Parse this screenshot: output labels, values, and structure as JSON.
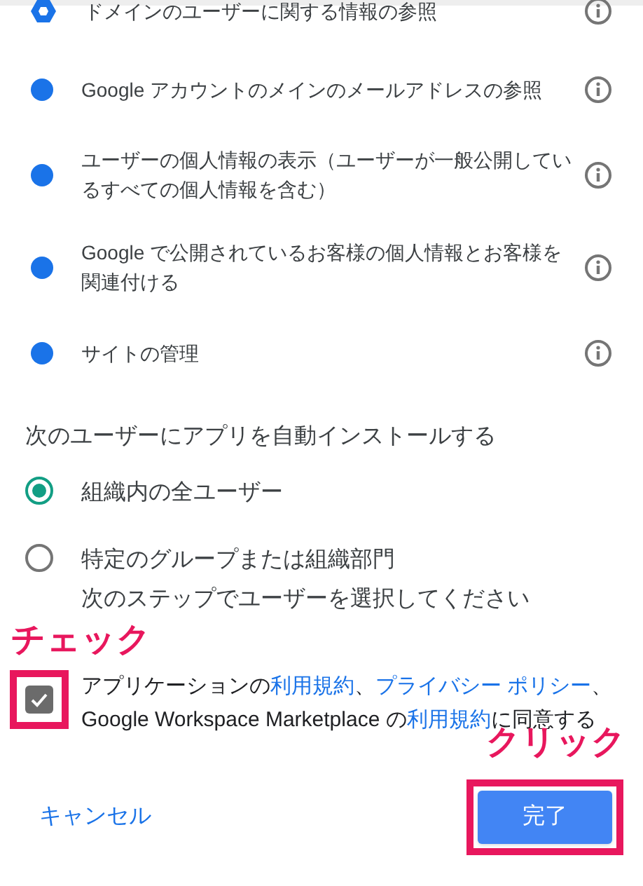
{
  "permissions": [
    {
      "text": "ドメインのユーザーに関する情報の参照",
      "kind": "hexagon"
    },
    {
      "text": "Google アカウントのメインのメールアドレスの参照",
      "kind": "dot"
    },
    {
      "text": "ユーザーの個人情報の表示（ユーザーが一般公開しているすべての個人情報を含む）",
      "kind": "dot"
    },
    {
      "text": "Google で公開されているお客様の個人情報とお客様を関連付ける",
      "kind": "dot"
    },
    {
      "text": "サイトの管理",
      "kind": "dot"
    }
  ],
  "install": {
    "heading": "次のユーザーにアプリを自動インストールする",
    "options": [
      {
        "label": "組織内の全ユーザー",
        "selected": true
      },
      {
        "label": "特定のグループまたは組織部門",
        "hint": "次のステップでユーザーを選択してください",
        "selected": false
      }
    ]
  },
  "consent": {
    "checked": true,
    "parts": [
      {
        "kind": "text",
        "text": "アプリケーションの"
      },
      {
        "kind": "link",
        "text": "利用規約"
      },
      {
        "kind": "text",
        "text": "、"
      },
      {
        "kind": "link",
        "text": "プライバシー ポリシー"
      },
      {
        "kind": "text",
        "text": "、Google Workspace Marketplace の"
      },
      {
        "kind": "link",
        "text": "利用規約"
      },
      {
        "kind": "text",
        "text": "に同意する"
      }
    ]
  },
  "cancel_button": "キャンセル",
  "done_button": "完了",
  "checkbox_callout": "チェック",
  "done_callout": "クリック"
}
